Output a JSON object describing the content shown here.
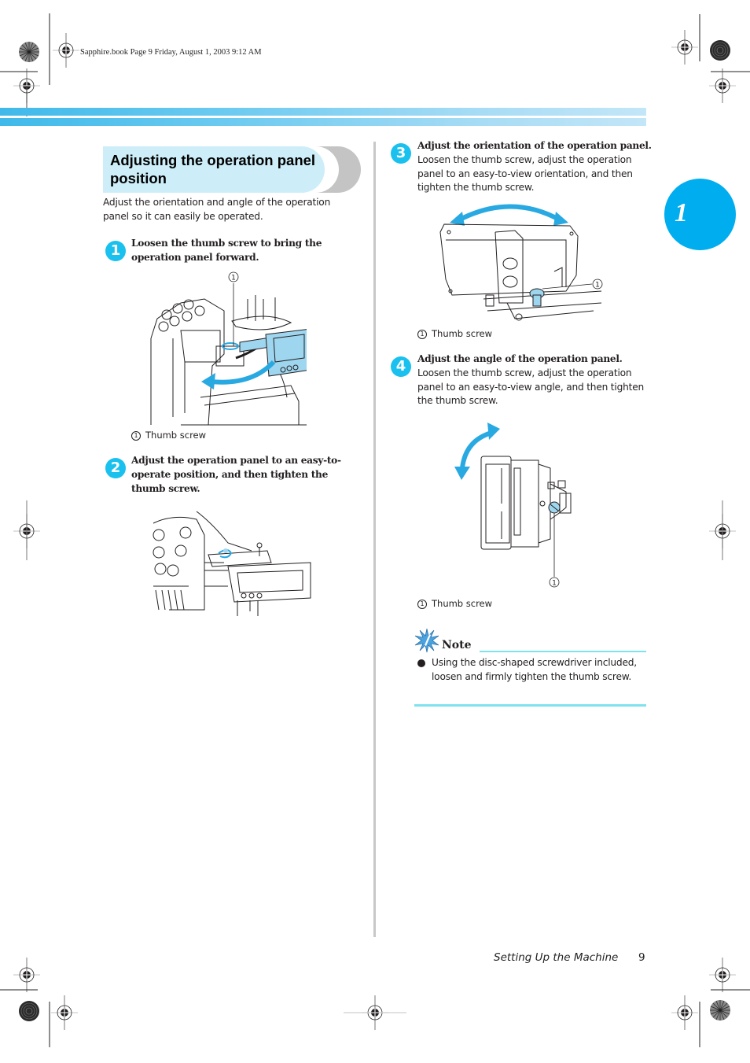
{
  "slug": "Sapphire.book  Page 9  Friday, August 1, 2003  9:12 AM",
  "chapter": {
    "number": "1",
    "color": "#00aeef"
  },
  "section": {
    "title": "Adjusting the operation panel position",
    "intro": "Adjust the orientation and angle of the operation panel so it can easily be operated."
  },
  "steps": [
    {
      "number": "1",
      "heading": "Loosen the thumb screw to bring the operation panel forward.",
      "body": "",
      "illustration": "machine-panel-swing-forward",
      "callout": "1",
      "caption_num": "1",
      "caption": "Thumb screw"
    },
    {
      "number": "2",
      "heading": "Adjust the operation panel to an easy-to-operate position, and then tighten the thumb screw.",
      "body": "",
      "illustration": "machine-panel-tightened",
      "caption": ""
    },
    {
      "number": "3",
      "heading": "Adjust the orientation of the operation panel.",
      "body": "Loosen the thumb screw, adjust the operation panel to an easy-to-view orientation, and then tighten the thumb screw.",
      "illustration": "panel-rear-orientation",
      "callout": "1",
      "caption_num": "1",
      "caption": "Thumb screw"
    },
    {
      "number": "4",
      "heading": "Adjust the angle of the operation panel.",
      "body": "Loosen the thumb screw, adjust the operation panel to an easy-to-view angle, and then tighten the thumb screw.",
      "illustration": "panel-side-angle",
      "callout": "1",
      "caption_num": "1",
      "caption": "Thumb screw"
    }
  ],
  "note": {
    "title": "Note",
    "items": [
      "Using the disc-shaped screwdriver included, loosen and firmly tighten the thumb screw."
    ]
  },
  "footer": {
    "title": "Setting Up the Machine",
    "page": "9"
  },
  "colors": {
    "accent": "#1ac1ee",
    "arrow": "#29a9e1",
    "title_bg": "#cdeef9",
    "note_rule": "#7fe2ee"
  }
}
